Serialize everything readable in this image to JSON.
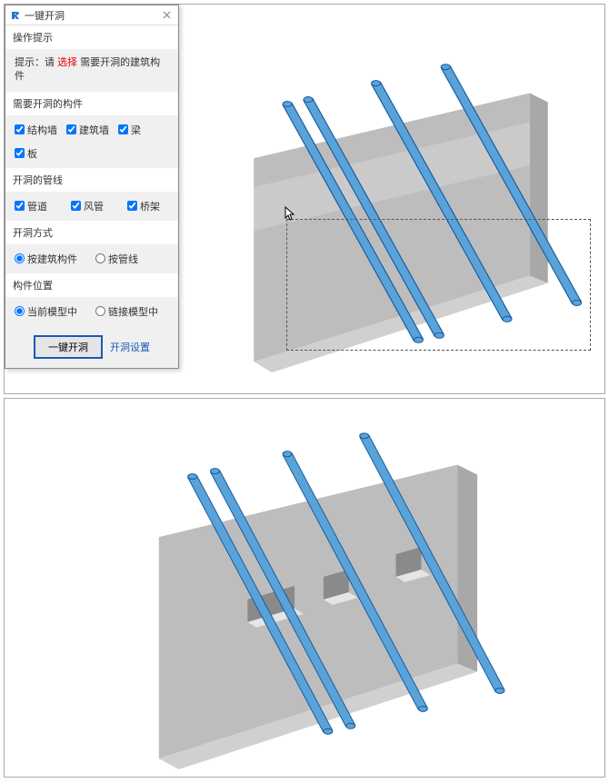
{
  "dialog": {
    "title": "一键开洞",
    "group_hint": {
      "header": "操作提示",
      "prefix": "提示：请 ",
      "select": "选择",
      "suffix": " 需要开洞的建筑构件"
    },
    "group_components": {
      "header": "需要开洞的构件",
      "items": [
        {
          "label": "结构墙",
          "checked": true
        },
        {
          "label": "建筑墙",
          "checked": true
        },
        {
          "label": "梁",
          "checked": true
        },
        {
          "label": "板",
          "checked": true
        }
      ]
    },
    "group_pipes": {
      "header": "开洞的管线",
      "items": [
        {
          "label": "管道",
          "checked": true
        },
        {
          "label": "风管",
          "checked": true
        },
        {
          "label": "桥架",
          "checked": true
        }
      ]
    },
    "group_method": {
      "header": "开洞方式",
      "items": [
        {
          "label": "按建筑构件",
          "checked": true
        },
        {
          "label": "按管线",
          "checked": false
        }
      ]
    },
    "group_location": {
      "header": "构件位置",
      "items": [
        {
          "label": "当前模型中",
          "checked": true
        },
        {
          "label": "链接模型中",
          "checked": false
        }
      ]
    },
    "footer": {
      "action": "一键开洞",
      "settings": "开洞设置"
    }
  }
}
